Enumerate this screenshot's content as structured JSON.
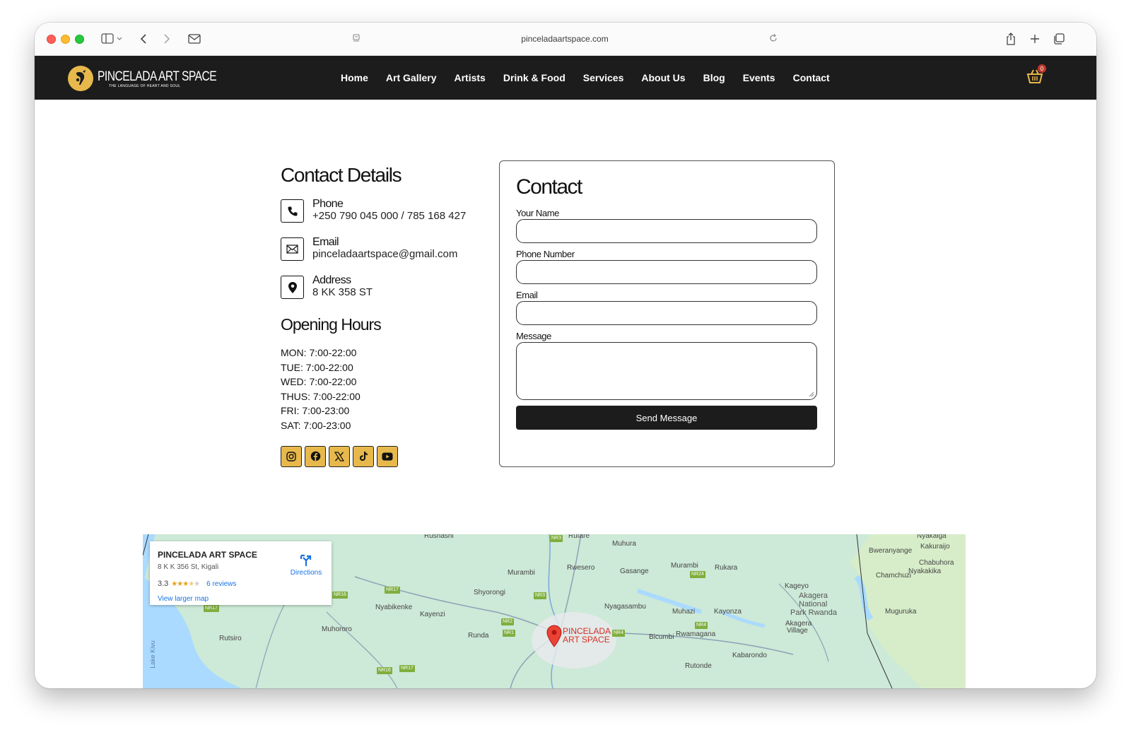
{
  "browser": {
    "url": "pinceladaartspace.com"
  },
  "site": {
    "logo_title": "PINCELADA ART SPACE",
    "logo_subtitle": "THE LANGUAGE OF HEART AND SOUL",
    "nav": [
      "Home",
      "Art Gallery",
      "Artists",
      "Drink & Food",
      "Services",
      "About Us",
      "Blog",
      "Events",
      "Contact"
    ],
    "cart_count": "0",
    "brand_color": "#e7b84b",
    "header_color": "#1c1c1c"
  },
  "details": {
    "heading": "Contact Details",
    "items": [
      {
        "icon": "phone-icon",
        "label": "Phone",
        "value": "+250 790 045 000 / 785 168 427"
      },
      {
        "icon": "envelope-icon",
        "label": "Email",
        "value": "pinceladaartspace@gmail.com"
      },
      {
        "icon": "location-pin-icon",
        "label": "Address",
        "value": "8 KK 358 ST"
      }
    ],
    "hours_heading": "Opening Hours",
    "hours": [
      "MON: 7:00-22:00",
      "TUE: 7:00-22:00",
      "WED: 7:00-22:00",
      "THUS: 7:00-22:00",
      "FRI: 7:00-23:00",
      "SAT: 7:00-23:00"
    ],
    "socials": [
      "instagram-icon",
      "facebook-icon",
      "x-icon",
      "tiktok-icon",
      "youtube-icon"
    ]
  },
  "form": {
    "heading": "Contact",
    "name_label": "Your Name",
    "name_value": "",
    "phone_label": "Phone Number",
    "phone_value": "",
    "email_label": "Email",
    "email_value": "",
    "message_label": "Message",
    "message_value": "",
    "submit_label": "Send Message"
  },
  "map": {
    "place_name": "PINCELADA ART SPACE",
    "place_address": "8 K K 356 St, Kigali",
    "rating": "3.3",
    "reviews": "6 reviews",
    "directions": "Directions",
    "larger_map": "View larger map",
    "pin_label_1": "PINCELADA",
    "pin_label_2": "ART SPACE",
    "places": [
      "Rushashi",
      "Rutare",
      "Muhura",
      "Nyakaiga",
      "Kakuraijo",
      "Bweranyange",
      "Chabuhora",
      "Murambi",
      "Rwesero",
      "Gasange",
      "Murambi",
      "Rukara",
      "Nyakakika",
      "Chamchuzi",
      "Shyorongi",
      "Kageyo",
      "Akagera",
      "National",
      "Park Rwanda",
      "Nyabikenke",
      "Nyagasambu",
      "Kayenzi",
      "Muhazi",
      "Kayonza",
      "Muguruka",
      "Muhororo",
      "Akagera",
      "Village",
      "Rutsiro",
      "Runda",
      "Bicumbi",
      "Rwamagana",
      "Kabarondo",
      "Rutonde",
      "Lake Kivu"
    ],
    "highways": [
      "NR3",
      "NR17",
      "NR3",
      "NR24",
      "NR16",
      "NR17",
      "NR2",
      "NR1",
      "NR4",
      "NR4",
      "NR16",
      "NR17"
    ]
  }
}
